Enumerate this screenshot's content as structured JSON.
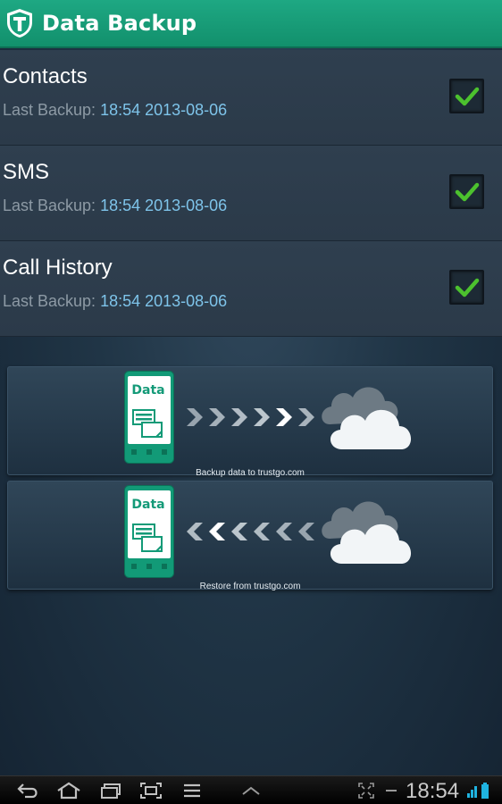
{
  "header": {
    "title": "Data Backup",
    "logo_icon": "shield-t-icon",
    "color": "#1ea883"
  },
  "backup_items": [
    {
      "name": "Contacts",
      "last_backup_label": "Last Backup:",
      "last_backup_value": "18:54 2013-08-06",
      "checked": true
    },
    {
      "name": "SMS",
      "last_backup_label": "Last Backup:",
      "last_backup_value": "18:54 2013-08-06",
      "checked": true
    },
    {
      "name": "Call History",
      "last_backup_label": "Last Backup:",
      "last_backup_value": "18:54 2013-08-06",
      "checked": true
    }
  ],
  "actions": {
    "backup": {
      "caption": "Backup data to trustgo.com",
      "phone_label": "Data"
    },
    "restore": {
      "caption": "Restore from trustgo.com",
      "phone_label": "Data"
    }
  },
  "statusbar": {
    "time": "18:54",
    "nav_icons": [
      "back-icon",
      "home-icon",
      "recent-apps-icon",
      "screenshot-icon",
      "menu-icon",
      "chevron-up-icon"
    ],
    "status_icons": [
      "fullscreen-icon",
      "minus-icon",
      "signal-icon",
      "battery-icon"
    ]
  }
}
